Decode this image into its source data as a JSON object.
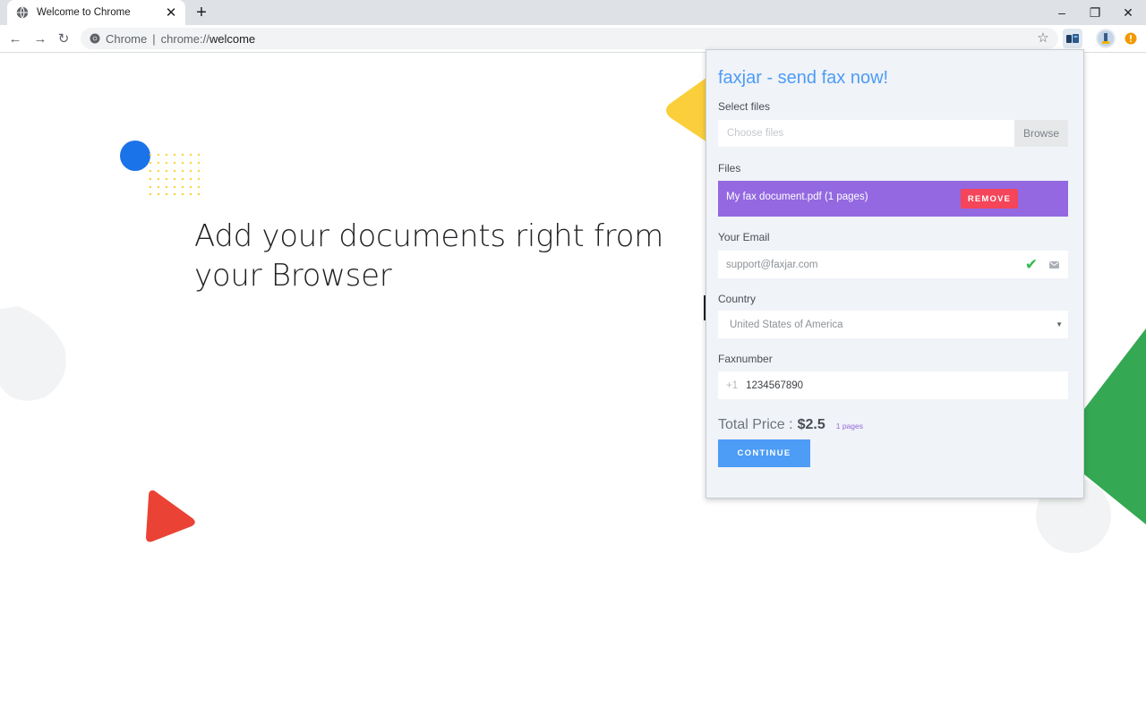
{
  "browser": {
    "tab": {
      "title": "Welcome to Chrome",
      "favicon": "globe-icon",
      "close": "✕"
    },
    "new_tab": "+",
    "window_controls": {
      "minimize": "–",
      "restore": "❐",
      "close": "✕"
    },
    "toolbar": {
      "back": "←",
      "forward": "→",
      "reload": "↻",
      "site_label": "Chrome",
      "separator": "|",
      "url_scheme": "chrome://",
      "url_host": "welcome",
      "star": "☆"
    }
  },
  "page": {
    "headline": "Add your documents right from your Browser"
  },
  "popup": {
    "title": "faxjar - send fax now!",
    "select_files_label": "Select files",
    "file_input_placeholder": "Choose files",
    "browse_label": "Browse",
    "files_label": "Files",
    "files": [
      {
        "name": "My fax document.pdf (1 pages)",
        "remove_label": "REMOVE"
      }
    ],
    "email_label": "Your Email",
    "email_value": "support@faxjar.com",
    "check": "✔",
    "country_label": "Country",
    "country_value": "United States of America",
    "caret": "▼",
    "faxnumber_label": "Faxnumber",
    "fax_prefix": "+1",
    "fax_value": "1234567890",
    "total_label": "Total Price :",
    "total_amount": "$2.5",
    "pages_badge": "1 pages",
    "continue_label": "CONTINUE"
  },
  "colors": {
    "accent_blue": "#4d9cf6",
    "file_row_purple": "#9368e0",
    "remove_red": "#f4455a",
    "deco_yellow": "#fbcf3b",
    "deco_blue": "#1a73e8",
    "deco_red": "#ea4335",
    "deco_green": "#34a853"
  }
}
